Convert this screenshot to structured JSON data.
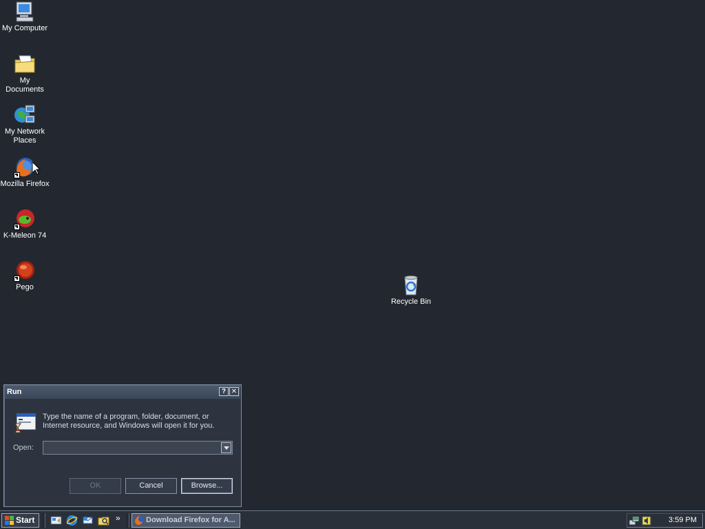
{
  "desktop": {
    "icons": [
      {
        "label": "My Computer",
        "icon": "computer-icon"
      },
      {
        "label": "My Documents",
        "icon": "documents-folder-icon"
      },
      {
        "label": "My Network Places",
        "icon": "network-places-icon"
      },
      {
        "label": "Mozilla Firefox",
        "icon": "firefox-icon"
      },
      {
        "label": "K-Meleon 74",
        "icon": "kmeleon-icon"
      },
      {
        "label": "Pego",
        "icon": "pego-icon"
      },
      {
        "label": "Recycle Bin",
        "icon": "recycle-bin-icon"
      }
    ]
  },
  "run_dialog": {
    "title": "Run",
    "help_label": "?",
    "close_label": "✕",
    "description": "Type the name of a program, folder, document, or Internet resource, and Windows will open it for you.",
    "open_label": "Open:",
    "open_value": "",
    "ok_label": "OK",
    "cancel_label": "Cancel",
    "browse_label": "Browse..."
  },
  "taskbar": {
    "start_label": "Start",
    "quick_launch": [
      "show-desktop-icon",
      "internet-explorer-icon",
      "outlook-express-icon",
      "windows-explorer-icon"
    ],
    "chevron": "»",
    "active_task": "Download Firefox for A...",
    "tray_icons": [
      "network-tray-icon",
      "volume-tray-icon"
    ],
    "clock": "3:59 PM"
  },
  "colors": {
    "desktop": "#232830",
    "dialog": "#2d3440",
    "taskbar": "#2a303a"
  }
}
